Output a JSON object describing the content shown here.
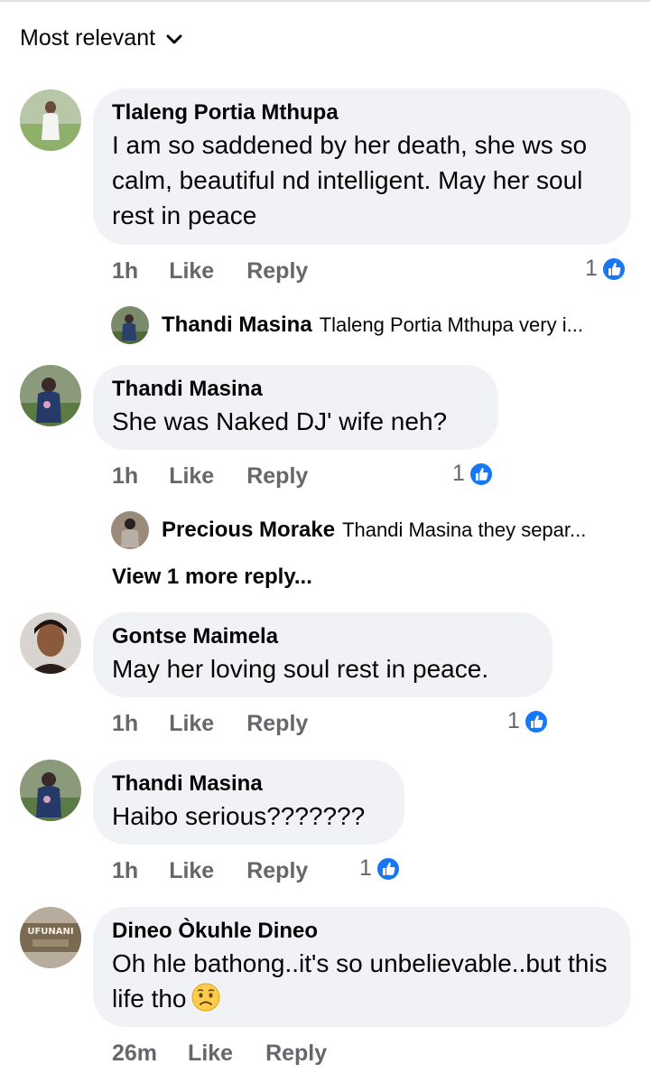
{
  "sort": {
    "label": "Most relevant"
  },
  "comments": [
    {
      "author": "Tlaleng Portia Mthupa",
      "text": "I am so saddened by her death, she ws so calm, beautiful nd intelligent. May her soul rest in peace",
      "time": "1h",
      "like_label": "Like",
      "reply_label": "Reply",
      "reaction_count": "1",
      "reply_preview": {
        "author": "Thandi Masina",
        "text": "Tlaleng Portia Mthupa very i..."
      }
    },
    {
      "author": "Thandi Masina",
      "text": "She was Naked DJ' wife neh?",
      "time": "1h",
      "like_label": "Like",
      "reply_label": "Reply",
      "reaction_count": "1",
      "reply_preview": {
        "author": "Precious Morake",
        "text": "Thandi Masina they separ..."
      },
      "more_replies": "View 1 more reply..."
    },
    {
      "author": "Gontse Maimela",
      "text": "May her loving soul rest in peace.",
      "time": "1h",
      "like_label": "Like",
      "reply_label": "Reply",
      "reaction_count": "1"
    },
    {
      "author": "Thandi Masina",
      "text": "Haibo serious???????",
      "time": "1h",
      "like_label": "Like",
      "reply_label": "Reply",
      "reaction_count": "1"
    },
    {
      "author": "Dineo Òkuhle Dineo",
      "text": "Oh hle bathong..it's so unbelievable..but this life tho",
      "emoji": "worried-face-emoji",
      "time": "26m",
      "like_label": "Like",
      "reply_label": "Reply",
      "avatar_text": "UFUNANI"
    }
  ],
  "colors": {
    "bubble": "#f0f2f5",
    "like_blue": "#1877f2",
    "meta_gray": "#65676b"
  },
  "icons": {
    "sort": "chevron-down-icon",
    "reaction": "thumbs-up-icon"
  }
}
